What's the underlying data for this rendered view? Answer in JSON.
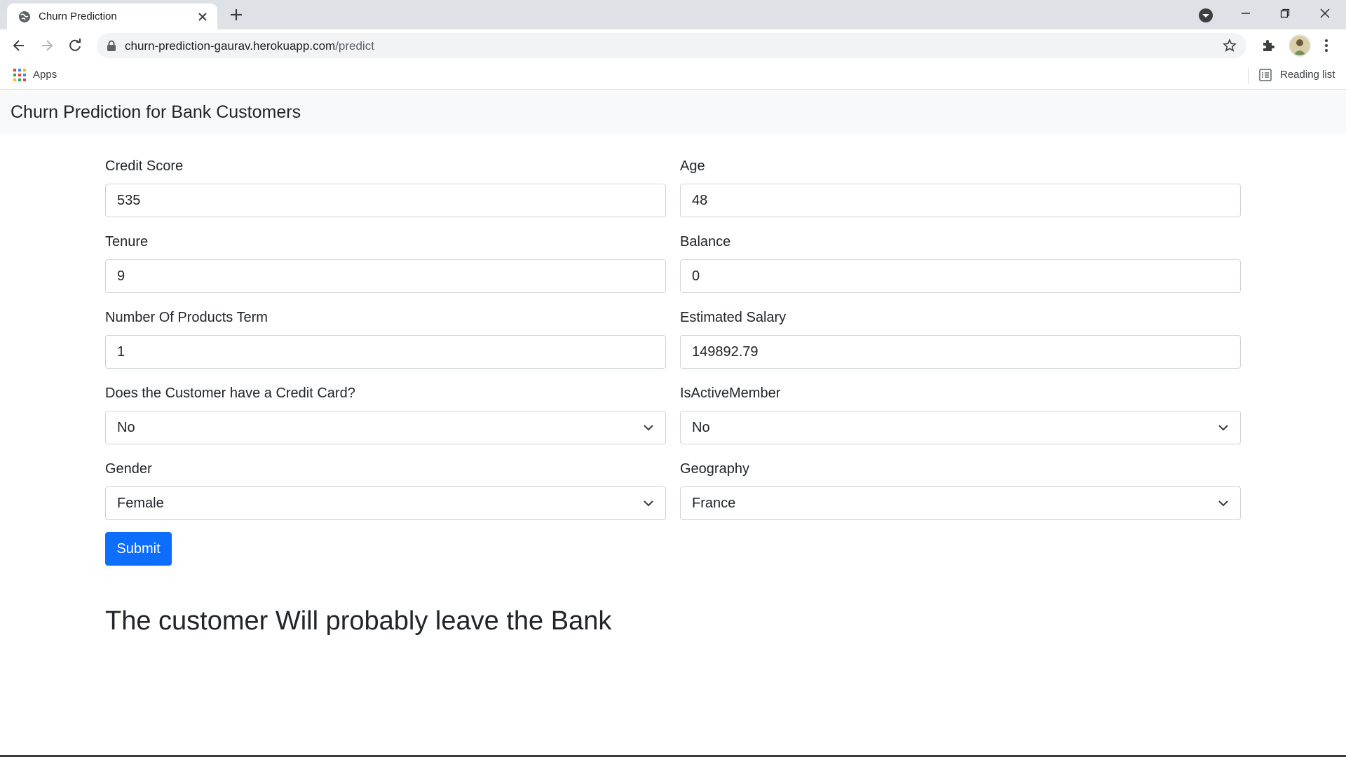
{
  "browser": {
    "tab_title": "Churn Prediction",
    "url_host": "churn-prediction-gaurav.herokuapp.com",
    "url_path": "/predict",
    "apps_label": "Apps",
    "reading_list_label": "Reading list"
  },
  "page": {
    "brand": "Churn Prediction for Bank Customers",
    "fields": [
      {
        "label": "Credit Score",
        "value": "535",
        "type": "input"
      },
      {
        "label": "Age",
        "value": "48",
        "type": "input"
      },
      {
        "label": "Tenure",
        "value": "9",
        "type": "input"
      },
      {
        "label": "Balance",
        "value": "0",
        "type": "input"
      },
      {
        "label": "Number Of Products Term",
        "value": "1",
        "type": "input"
      },
      {
        "label": "Estimated Salary",
        "value": "149892.79",
        "type": "input"
      },
      {
        "label": "Does the Customer have a Credit Card?",
        "value": "No",
        "type": "select"
      },
      {
        "label": "IsActiveMember",
        "value": "No",
        "type": "select"
      },
      {
        "label": "Gender",
        "value": "Female",
        "type": "select"
      },
      {
        "label": "Geography",
        "value": "France",
        "type": "select"
      }
    ],
    "submit_label": "Submit",
    "result_text": "The customer Will probably leave the Bank"
  },
  "colors": {
    "primary_button": "#0d6efd",
    "navbar_bg": "#f8f9fa",
    "tabstrip_bg": "#dee1e6"
  }
}
